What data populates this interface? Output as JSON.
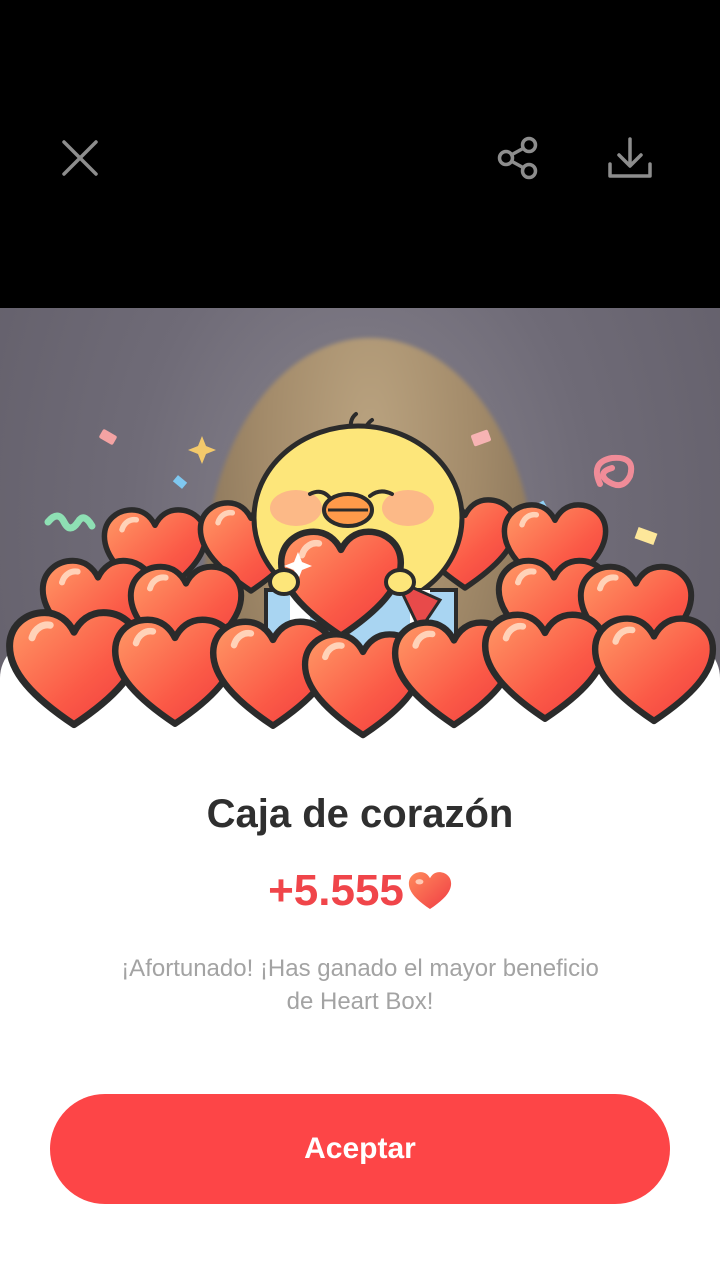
{
  "topbar": {
    "close_icon": "close-icon",
    "share_icon": "share-icon",
    "download_icon": "download-icon"
  },
  "illustration": {
    "name": "heart-box-chick-illustration"
  },
  "reward": {
    "title": "Caja de corazón",
    "amount": "+5.555",
    "currency_icon": "heart-icon",
    "description": "¡Afortunado! ¡Has ganado el mayor beneficio de Heart Box!",
    "accept_label": "Aceptar"
  },
  "colors": {
    "accent": "#fd4547",
    "amount": "#f0454a",
    "title": "#2f2f2f",
    "description": "#a3a3a3"
  }
}
